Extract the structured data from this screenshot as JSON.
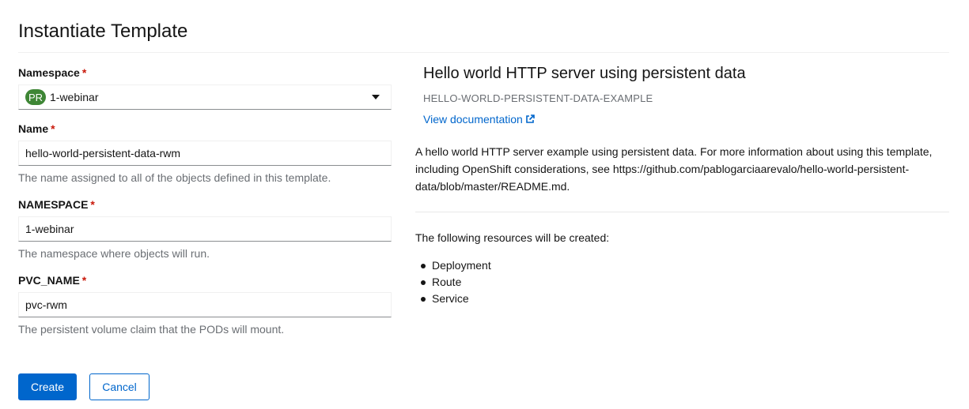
{
  "page": {
    "title": "Instantiate Template"
  },
  "form": {
    "namespace_select": {
      "label": "Namespace",
      "required_mark": "*",
      "badge": "PR",
      "value": "1-webinar"
    },
    "fields": [
      {
        "label": "Name",
        "required_mark": "*",
        "value": "hello-world-persistent-data-rwm",
        "help": "The name assigned to all of the objects defined in this template."
      },
      {
        "label": "NAMESPACE",
        "required_mark": "*",
        "value": "1-webinar",
        "help": "The namespace where objects will run."
      },
      {
        "label": "PVC_NAME",
        "required_mark": "*",
        "value": "pvc-rwm",
        "help": "The persistent volume claim that the PODs will mount."
      }
    ],
    "buttons": {
      "create": "Create",
      "cancel": "Cancel"
    }
  },
  "template_info": {
    "name": "Hello world HTTP server using persistent data",
    "id": "HELLO-WORLD-PERSISTENT-DATA-EXAMPLE",
    "doc_link": "View documentation",
    "description": "A hello world HTTP server example using persistent data. For more information about using this template, including OpenShift considerations, see https://github.com/pablogarciaarevalo/hello-world-persistent-data/blob/master/README.md.",
    "resources_intro": "The following resources will be created:",
    "resources": [
      "Deployment",
      "Route",
      "Service"
    ]
  },
  "colors": {
    "primary": "#0066cc",
    "required": "#c9190b",
    "project_badge": "#3e8635"
  },
  "icons": {
    "doc_link": "external-link-icon",
    "namespace": "project-badge",
    "dropdown": "caret-down-icon"
  }
}
